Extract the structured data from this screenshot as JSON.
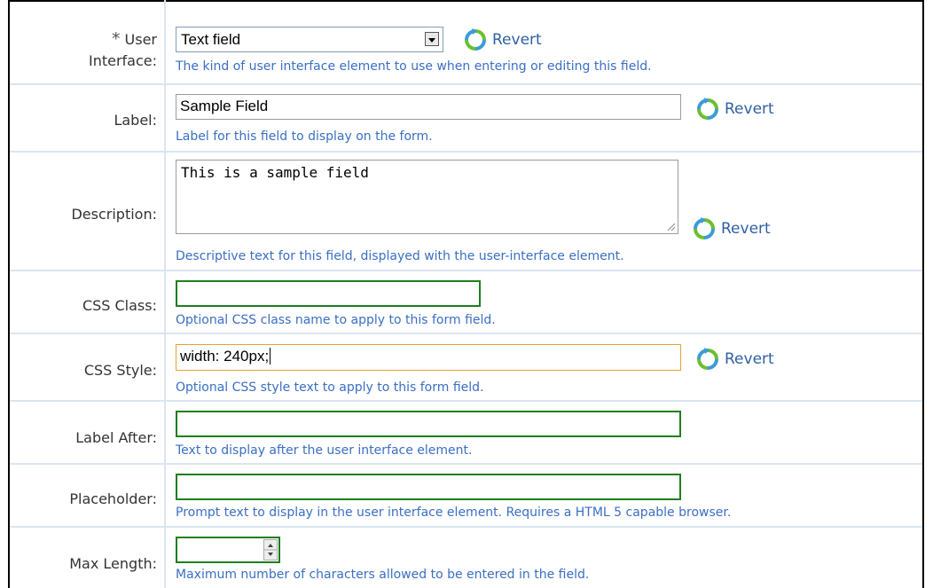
{
  "rows": {
    "user_interface": {
      "required_mark": "*",
      "label_line1": "User",
      "label_line2": "Interface:",
      "value": "Text field",
      "revert": "Revert",
      "help": "The kind of user interface element to use when entering or editing this field."
    },
    "label": {
      "label": "Label:",
      "value": "Sample Field",
      "revert": "Revert",
      "help": "Label for this field to display on the form."
    },
    "description": {
      "label": "Description:",
      "value": "This is a sample field",
      "revert": "Revert",
      "help": "Descriptive text for this field, displayed with the user-interface element."
    },
    "css_class": {
      "label": "CSS Class:",
      "value": "",
      "help": "Optional CSS class name to apply to this form field."
    },
    "css_style": {
      "label": "CSS Style:",
      "value": "width: 240px;",
      "revert": "Revert",
      "help": "Optional CSS style text to apply to this form field."
    },
    "label_after": {
      "label": "Label After:",
      "value": "",
      "help": "Text to display after the user interface element."
    },
    "placeholder": {
      "label": "Placeholder:",
      "value": "",
      "help": "Prompt text to display in the user interface element. Requires a HTML 5 capable browser."
    },
    "max_length": {
      "label": "Max Length:",
      "value": "",
      "help": "Maximum number of characters allowed to be entered in the field."
    }
  },
  "icons": {
    "revert": "revert-icon",
    "dropdown": "chevron-down-icon",
    "spinner": "spinner-arrows-icon"
  },
  "colors": {
    "help_text": "#3a6fc4",
    "valid_border": "#1d7f1d",
    "focus_border": "#e5a230",
    "divider": "#dbe5f2"
  }
}
